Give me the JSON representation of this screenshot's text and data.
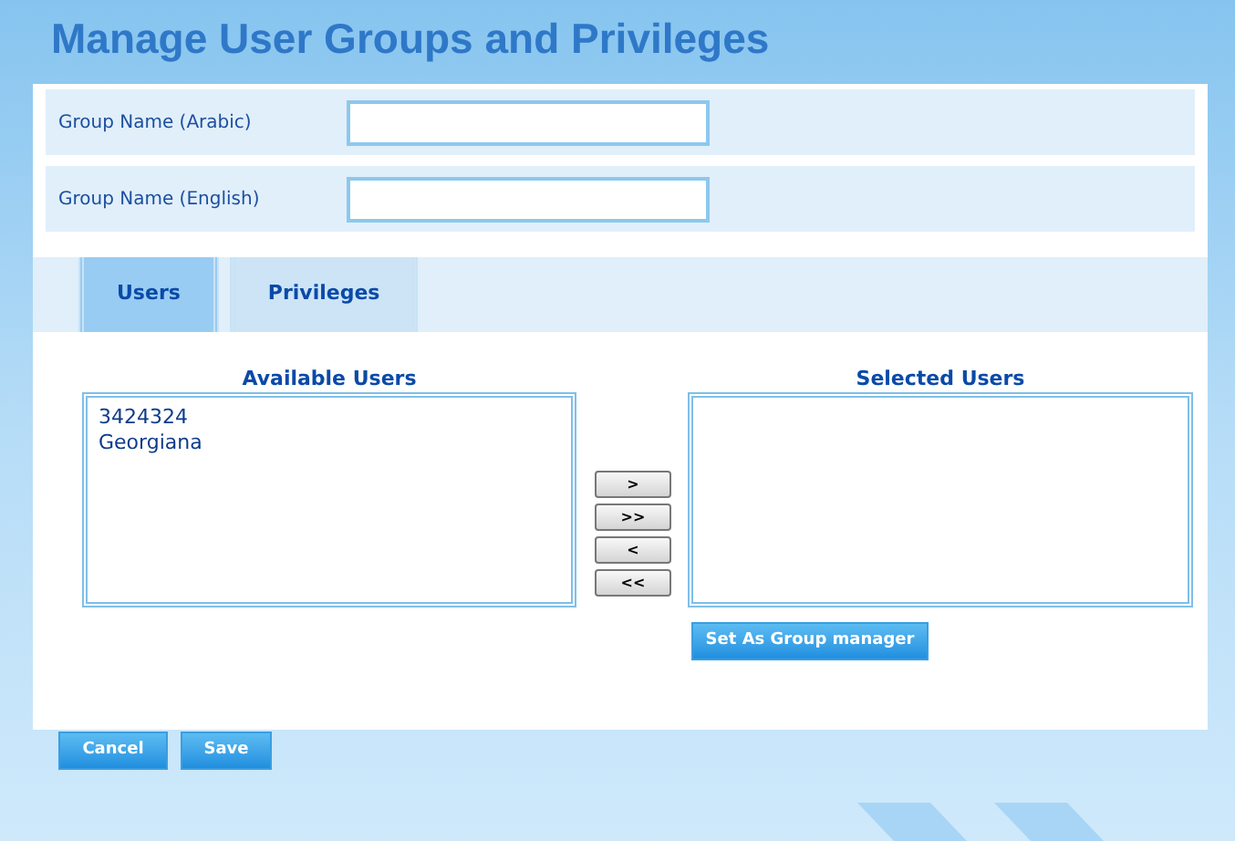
{
  "page": {
    "title": "Manage User Groups and Privileges"
  },
  "fields": [
    {
      "label": "Group Name (Arabic)"
    },
    {
      "label": "Group Name (English)"
    }
  ],
  "tabs": [
    {
      "label": "Users",
      "selected": true
    },
    {
      "label": "Privileges",
      "selected": false
    }
  ],
  "available_users": {
    "title": "Available Users",
    "items": [
      "3424324",
      "Georgiana"
    ]
  },
  "transfer_buttons": [
    ">",
    ">>",
    "<",
    "<<"
  ],
  "selected_users": {
    "title": "Selected Users"
  },
  "set_manager_button": "Set As Group manager",
  "buttons": [
    "Cancel",
    "Save"
  ]
}
